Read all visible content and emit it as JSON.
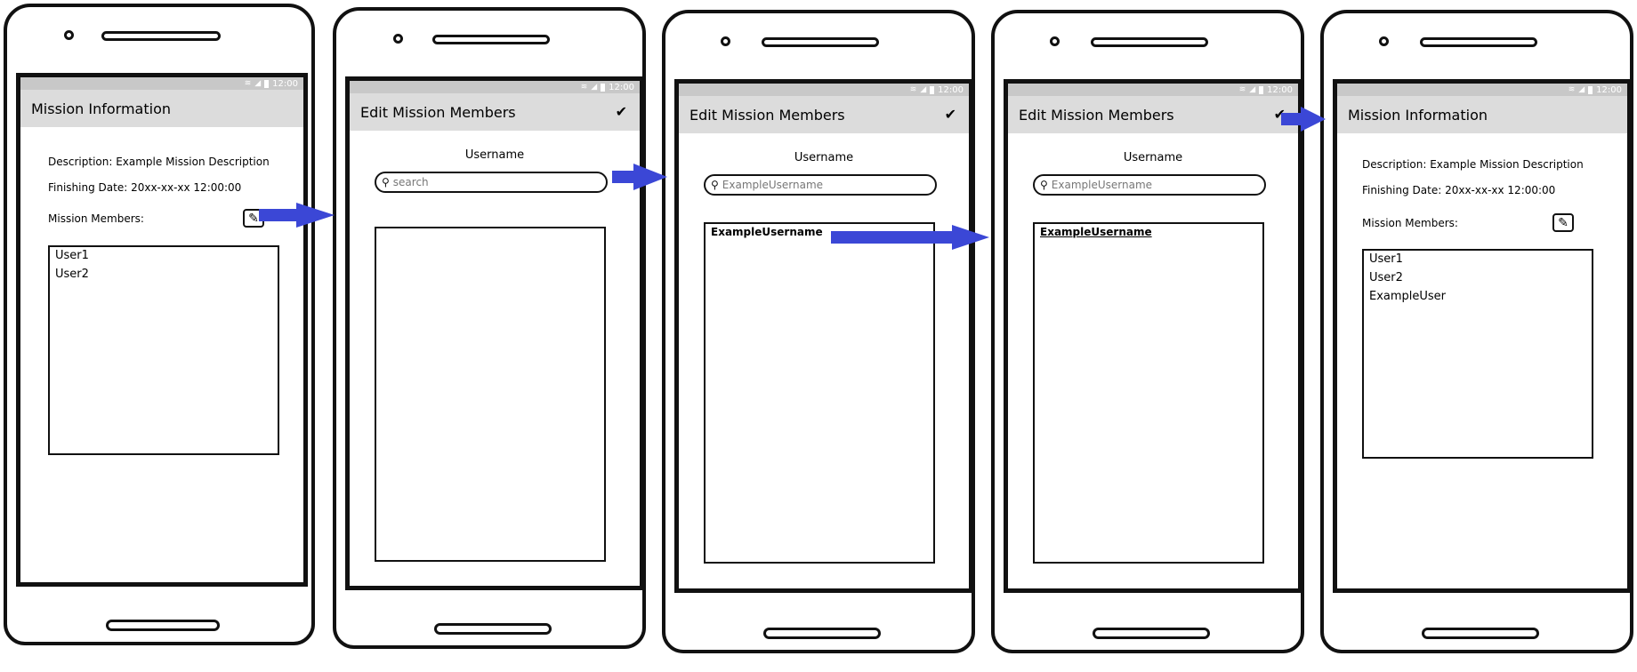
{
  "status_bar": {
    "time": "12:00"
  },
  "screens": {
    "mission_info_1": {
      "title": "Mission Information",
      "description": "Description: Example Mission Description",
      "finishing_date": "Finishing Date: 20xx-xx-xx 12:00:00",
      "members_label": "Mission Members:",
      "members": [
        "User1",
        "User2"
      ]
    },
    "edit_members_1": {
      "title": "Edit Mission Members",
      "field_label": "Username",
      "search_placeholder": "search"
    },
    "edit_members_2": {
      "title": "Edit Mission Members",
      "field_label": "Username",
      "search_value": "ExampleUsername",
      "result": "ExampleUsername"
    },
    "edit_members_3": {
      "title": "Edit Mission Members",
      "field_label": "Username",
      "search_value": "ExampleUsername",
      "result": "ExampleUsername"
    },
    "mission_info_2": {
      "title": "Mission Information",
      "description": "Description: Example Mission Description",
      "finishing_date": "Finishing Date: 20xx-xx-xx 12:00:00",
      "members_label": "Mission Members:",
      "members": [
        "User1",
        "User2",
        "ExampleUser"
      ]
    }
  },
  "icons": {
    "edit": "pencil-square-icon",
    "check": "checkmark-icon",
    "search": "magnifier-icon",
    "wifi": "wifi-icon",
    "signal": "signal-icon",
    "battery": "battery-icon"
  },
  "colors": {
    "arrow": "#3b47d6",
    "titlebar": "#dcdcdc",
    "statusbar": "#c8c8c8"
  }
}
